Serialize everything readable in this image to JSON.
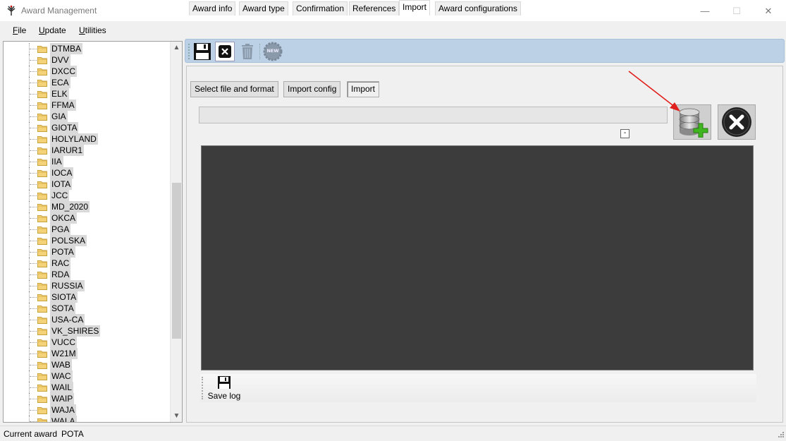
{
  "window": {
    "title": "Award Management",
    "minimize": "—",
    "maximize": "☐",
    "close": "✕"
  },
  "menu": [
    {
      "label": "File",
      "mnemonic_index": 0
    },
    {
      "label": "Update",
      "mnemonic_index": 0
    },
    {
      "label": "Utilities",
      "mnemonic_index": 0
    }
  ],
  "tree": {
    "items": [
      "DTMBA",
      "DVV",
      "DXCC",
      "ECA",
      "ELK",
      "FFMA",
      "GIA",
      "GIOTA",
      "HOLYLAND",
      "IARUR1",
      "IIA",
      "IOCA",
      "IOTA",
      "JCC",
      "MD_2020",
      "OKCA",
      "PGA",
      "POLSKA",
      "POTA",
      "RAC",
      "RDA",
      "RUSSIA",
      "SIOTA",
      "SOTA",
      "USA-CA",
      "VK_SHIRES",
      "VUCC",
      "W21M",
      "WAB",
      "WAC",
      "WAIL",
      "WAIP",
      "WAJA",
      "WALA"
    ],
    "scroll_up": "▲",
    "scroll_down": "▼"
  },
  "toolbar": {
    "save_icon": "floppy-disk-icon",
    "close_icon": "close-record-icon",
    "delete_icon": "trash-icon",
    "new_label": "NEW"
  },
  "tabs": [
    {
      "label": "Award info",
      "active": false
    },
    {
      "label": "Award type",
      "active": false
    },
    {
      "label": "Confirmation",
      "active": false
    },
    {
      "label": "References",
      "active": false
    },
    {
      "label": "Import",
      "active": true
    },
    {
      "label": "Award configurations",
      "active": false
    }
  ],
  "subtabs": [
    {
      "label": "Select file and format",
      "active": false
    },
    {
      "label": "Import config",
      "active": false
    },
    {
      "label": "Import",
      "active": true
    }
  ],
  "import_panel": {
    "progress": 0,
    "collapse_label": "-",
    "import_button_icon": "database-add-icon",
    "cancel_button_icon": "cancel-circle-icon"
  },
  "log": {
    "save_label": "Save log"
  },
  "status": {
    "label": "Current award",
    "value": "POTA"
  },
  "colors": {
    "toolbar_bg": "#bcd0e6",
    "log_bg": "#3c3c3c",
    "arrow": "#e0201c",
    "selection_bg": "#d9d9d9"
  }
}
